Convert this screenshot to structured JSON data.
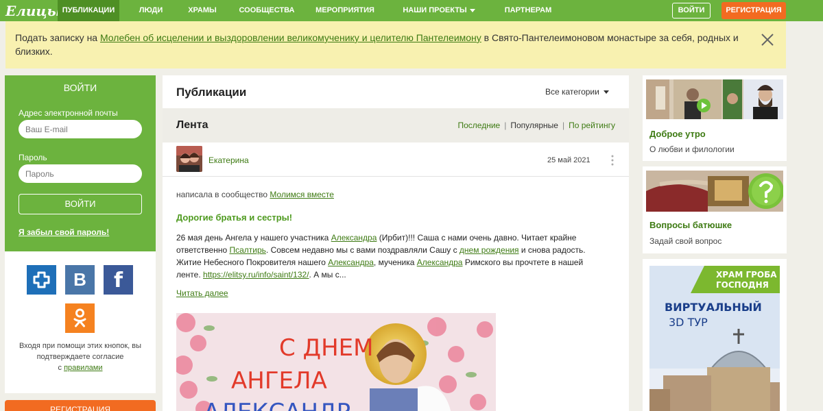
{
  "brand": {
    "logo_text": "Елицы",
    "green": "#6cb33e",
    "orange": "#f26b21"
  },
  "nav": {
    "items": [
      {
        "label": "Публикации",
        "active": true
      },
      {
        "label": "Люди"
      },
      {
        "label": "Храмы"
      },
      {
        "label": "Сообщества"
      },
      {
        "label": "Мероприятия"
      },
      {
        "label": "Наши проекты",
        "dropdown": true
      },
      {
        "label": "Партнерам"
      }
    ],
    "login_label": "Войти",
    "register_label": "Регистрация"
  },
  "banner": {
    "prefix": "Подать записку на ",
    "link": "Молебен об исцелении и выздоровлении великомученику и целителю Пантелеимону",
    "suffix": " в Свято-Пантелеимоновом монастыре за себя, родных и близких."
  },
  "login": {
    "title": "Войти",
    "email_label": "Адрес электронной почты",
    "email_placeholder": "Ваш E-mail",
    "password_label": "Пароль",
    "password_placeholder": "Пароль",
    "submit_label": "Войти",
    "forgot_label": "Я забыл свой пароль!",
    "social_note": "Входя при помощи этих кнопок, вы подтверждаете согласие",
    "social_note_prefix": "с ",
    "social_note_link": "правилами",
    "register_label": "Регистрация"
  },
  "social": [
    {
      "name": "cross-network",
      "color": "#1e6fb8"
    },
    {
      "name": "vk",
      "glyph": "B",
      "color": "#4a76a8"
    },
    {
      "name": "facebook",
      "glyph": "f",
      "color": "#3b5998"
    },
    {
      "name": "odnoklassniki",
      "color": "#f58220"
    }
  ],
  "publications": {
    "title": "Публикации",
    "categories_label": "Все категории",
    "feed_title": "Лента",
    "sort": [
      "Последние",
      "Популярные",
      "По рейтингу"
    ],
    "sort_active": 1
  },
  "post": {
    "author": "Екатерина",
    "date": "25 май 2021",
    "community_prefix": "написала в сообщество ",
    "community": "Молимся вместе",
    "heading": "Дорогие братья и сестры!",
    "body": [
      {
        "t": "26 мая день Ангела у нашего участника "
      },
      {
        "l": "Александра"
      },
      {
        "t": " (Ирбит)!!! Саша с нами очень давно. Читает крайне ответственно "
      },
      {
        "l": "Псалтирь"
      },
      {
        "t": ". Совсем недавно мы с вами поздравляли Сашу с "
      },
      {
        "l": "днем рождения"
      },
      {
        "t": " и снова радость. Житие Небесного Покровителя нашего "
      },
      {
        "l": "Александра"
      },
      {
        "t": ", мученика "
      },
      {
        "l": "Александра"
      },
      {
        "t": " Римского вы прочтете в нашей ленте. "
      },
      {
        "l": "https://elitsy.ru/info/saint/132/"
      },
      {
        "t": ". А мы с..."
      }
    ],
    "read_more": "Читать далее",
    "image_caption_line1": "С ДНЕМ",
    "image_caption_line2": "АНГЕЛА",
    "image_caption_line3": "АЛЕКСАНДР"
  },
  "widgets": [
    {
      "title": "Доброе утро",
      "subtitle": "О любви и филологии"
    },
    {
      "title": "Вопросы батюшке",
      "subtitle": "Задай свой вопрос"
    },
    {
      "ad_line1": "ХРАМ ГРОБА",
      "ad_line2": "ГОСПОДНЯ",
      "ad_line3": "ВИРТУАЛЬНЫЙ",
      "ad_line4": "3D ТУР"
    }
  ]
}
